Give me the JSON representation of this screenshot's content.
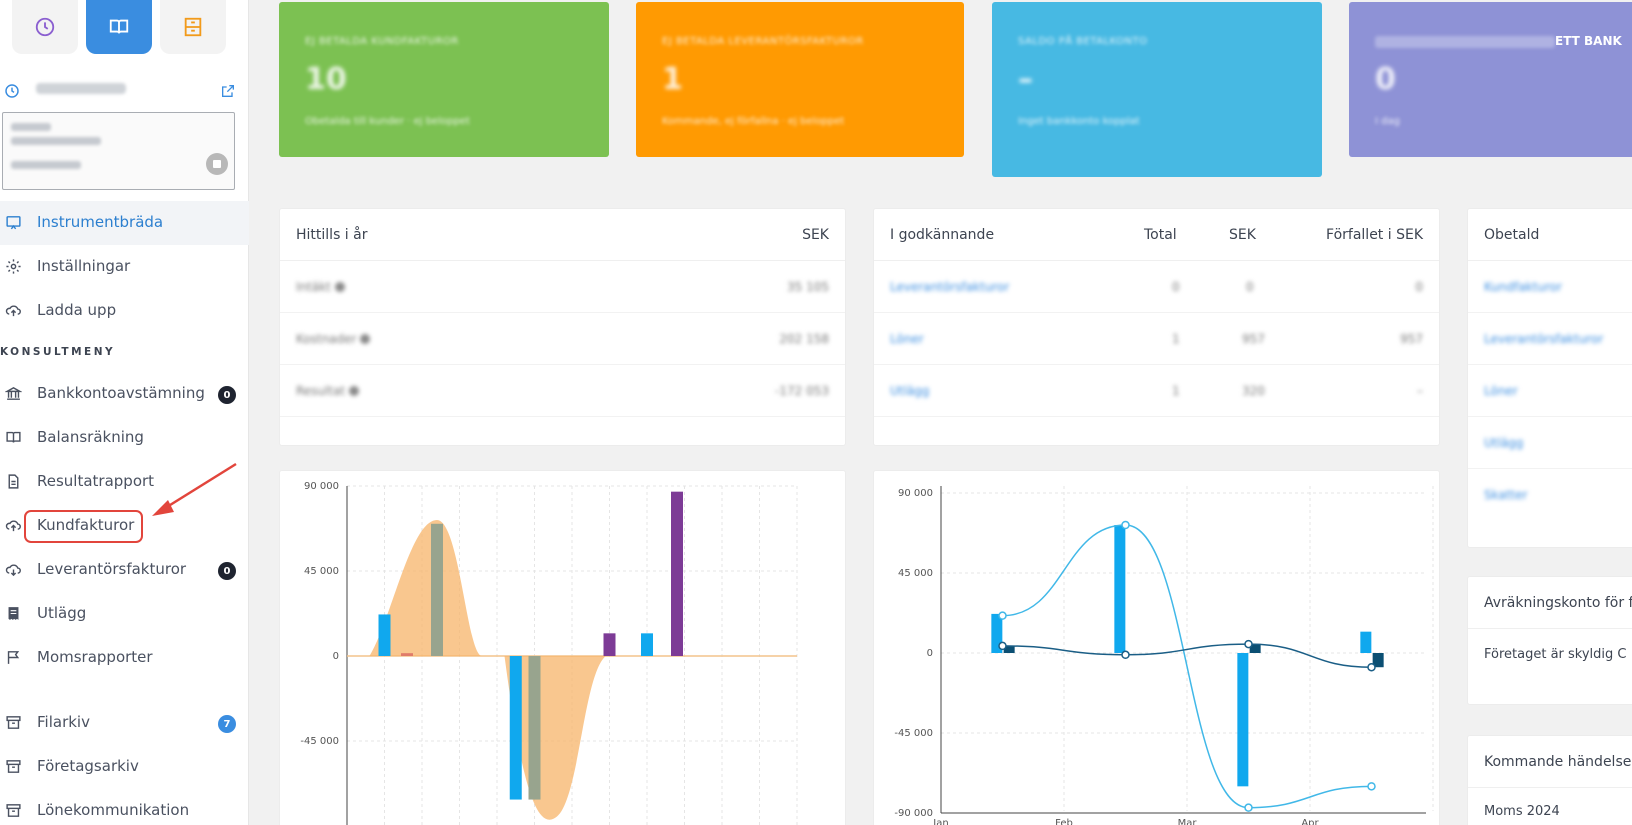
{
  "sidebar": {
    "tracker_label": "Task & Time",
    "nav": [
      {
        "label": "Instrumentbräda",
        "icon": "dashboard-icon"
      },
      {
        "label": "Inställningar",
        "icon": "gear-icon"
      },
      {
        "label": "Ladda upp",
        "icon": "cloud-upload-icon"
      }
    ],
    "section": "KONSULTMENY",
    "menu": [
      {
        "label": "Bankkontoavstämning",
        "badge": "0",
        "icon": "bank-icon"
      },
      {
        "label": "Balansräkning",
        "icon": "book-icon"
      },
      {
        "label": "Resultatrapport",
        "icon": "document-icon"
      },
      {
        "label": "Kundfakturor",
        "icon": "cloud-upload-icon"
      },
      {
        "label": "Leverantörsfakturor",
        "badge": "0",
        "icon": "cloud-download-icon"
      },
      {
        "label": "Utlägg",
        "icon": "receipt-icon"
      },
      {
        "label": "Momsrapporter",
        "icon": "flag-icon"
      },
      {
        "label": "Filarkiv",
        "badge": "7",
        "icon": "archive-icon"
      },
      {
        "label": "Företagsarkiv",
        "icon": "archive-icon"
      },
      {
        "label": "Lönekommunikation",
        "icon": "archive-icon"
      }
    ]
  },
  "kpis": [
    {
      "title": "EJ BETALDA KUNDFAKTUROR",
      "value": "10",
      "sub": "Obetalda till kunder · ej beloppet",
      "color": "#7cc152"
    },
    {
      "title": "EJ BETALDA LEVERANTÖRSFAKTUROR",
      "value": "1",
      "sub": "Kommande, ej förfallna · ej beloppet",
      "color": "#ff9a02"
    },
    {
      "title": "SALDO PÅ BETALKONTO",
      "value": "–",
      "sub": "Inget bankkonto kopplat",
      "color": "#47b9e3"
    },
    {
      "title": "ETT BANK",
      "value": "0",
      "sub": "I dag",
      "color": "#8e92d6"
    }
  ],
  "panel_year": {
    "title": "Hittills i år",
    "currency": "SEK",
    "rows": [
      {
        "label": "Intäkt",
        "value": "35 105"
      },
      {
        "label": "Kostnader",
        "value": "202 158"
      },
      {
        "label": "Resultat",
        "value": "-172 053"
      }
    ]
  },
  "panel_approval": {
    "title": "I godkännande",
    "col_total": "Total",
    "col_sek": "SEK",
    "col_overdue": "Förfallet i SEK",
    "rows": [
      {
        "label": "Leverantörsfakturor",
        "total": "0",
        "sek": "0",
        "overdue": "0"
      },
      {
        "label": "Löner",
        "total": "1",
        "sek": "957",
        "overdue": "957"
      },
      {
        "label": "Utlägg",
        "total": "1",
        "sek": "320",
        "overdue": "–"
      }
    ]
  },
  "panel_unpaid": {
    "title": "Obetald",
    "rows": [
      "Kundfakturor",
      "Leverantörsfakturor",
      "Löner",
      "Utlägg",
      "Skatter"
    ]
  },
  "panel_settlement": {
    "title": "Avräkningskonto för f",
    "body": "Företaget är skyldig C"
  },
  "panel_events": {
    "title": "Kommande händelse",
    "body": "Moms 2024"
  },
  "chart_data": [
    {
      "type": "bar",
      "y_ticks": [
        "90 000",
        "45 000",
        "0",
        "-45 000"
      ],
      "ylim": [
        -90000,
        90000
      ],
      "bars": [
        {
          "x": 1,
          "value": 22000,
          "color": "#10a8ee"
        },
        {
          "x": 1.6,
          "value": 1500,
          "color": "#e07c6a"
        },
        {
          "x": 2.4,
          "value": 70000,
          "color": "#98a48e"
        },
        {
          "x": 4.5,
          "value": -76000,
          "color": "#10a8ee"
        },
        {
          "x": 5.0,
          "value": -76000,
          "color": "#98a48e"
        },
        {
          "x": 7.0,
          "value": 12000,
          "color": "#7d3b96"
        },
        {
          "x": 8.0,
          "value": 12000,
          "color": "#10a8ee"
        },
        {
          "x": 8.8,
          "value": 87000,
          "color": "#7d3b96"
        }
      ],
      "area_color": "#f7b469"
    },
    {
      "type": "line",
      "y_ticks": [
        "90 000",
        "45 000",
        "0",
        "-45 000",
        "-90 000"
      ],
      "ylim": [
        -90000,
        90000
      ],
      "x_ticks": [
        "Jan",
        "Feb",
        "Mar",
        "Apr"
      ],
      "bars": [
        {
          "x": 0.45,
          "value": 22000,
          "color": "#10a8ee"
        },
        {
          "x": 0.55,
          "value": 4000,
          "color": "#0b4f73"
        },
        {
          "x": 1.45,
          "value": 72000,
          "color": "#10a8ee"
        },
        {
          "x": 2.45,
          "value": -75000,
          "color": "#10a8ee"
        },
        {
          "x": 2.55,
          "value": 5000,
          "color": "#0b4f73"
        },
        {
          "x": 3.45,
          "value": 12000,
          "color": "#10a8ee"
        },
        {
          "x": 3.55,
          "value": -8000,
          "color": "#0b4f73"
        }
      ],
      "series": [
        {
          "points": [
            [
              0.5,
              21000
            ],
            [
              1.5,
              72000
            ],
            [
              2.5,
              -87000
            ],
            [
              3.5,
              -75000
            ]
          ],
          "color": "#41b8e8"
        },
        {
          "points": [
            [
              0.5,
              4000
            ],
            [
              1.5,
              -1000
            ],
            [
              2.5,
              5000
            ],
            [
              3.5,
              -8000
            ]
          ],
          "color": "#1a5e86"
        }
      ]
    }
  ]
}
